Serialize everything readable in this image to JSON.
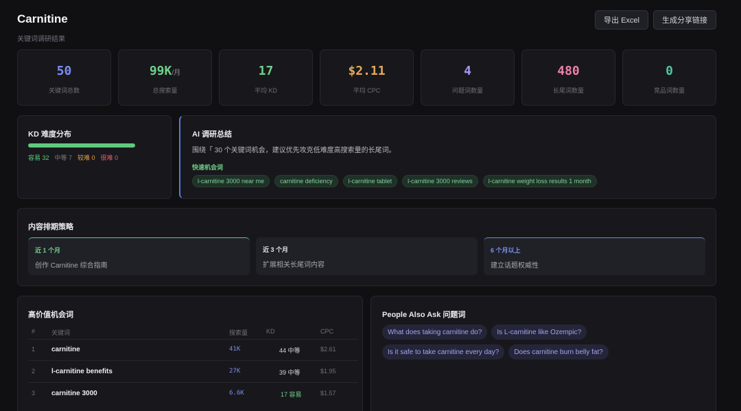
{
  "header": {
    "title": "Carnitine",
    "subtitle": "关键词调研结果",
    "export_label": "导出 Excel",
    "share_label": "生成分享链接"
  },
  "stats": [
    {
      "value": "50",
      "unit": "",
      "label": "关键词总数",
      "color": "#7b8cf5"
    },
    {
      "value": "99K",
      "unit": "/月",
      "label": "总搜索量",
      "color": "#6fd18a"
    },
    {
      "value": "17",
      "unit": "",
      "label": "平均 KD",
      "color": "#6fd18a"
    },
    {
      "value": "$2.11",
      "unit": "",
      "label": "平均 CPC",
      "color": "#e5a95a"
    },
    {
      "value": "4",
      "unit": "",
      "label": "问题词数量",
      "color": "#a598f2"
    },
    {
      "value": "480",
      "unit": "",
      "label": "长尾词数量",
      "color": "#ef7fa8"
    },
    {
      "value": "0",
      "unit": "",
      "label": "竞品词数量",
      "color": "#4fc49c"
    }
  ],
  "kd": {
    "title": "KD 难度分布",
    "easy_label": "容易 32",
    "medium_label": "中等 7",
    "hard_label": "较难 0",
    "very_hard_label": "很难 0",
    "easy_color": "#5fca7d",
    "medium_color": "#7a7a84",
    "hard_color": "#e3a04f",
    "very_hard_color": "#e0616f"
  },
  "ai": {
    "title": "AI 调研总结",
    "summary": "围绕「 30 个关键词机会，建议优先攻克低难度高搜索量的长尾词。",
    "quick_title": "快速机会词",
    "tags": [
      "l-carnitine 3000 near me",
      "carnitine deficiency",
      "l-carnitine tablet",
      "l-carnitine 3000 reviews",
      "l-carnitine weight loss results 1 month"
    ]
  },
  "strategy": {
    "title": "内容排期策略",
    "items": [
      {
        "period": "近 1 个月",
        "text": "创作 Carnitine 综合指南",
        "color": "#6fd18a"
      },
      {
        "period": "近 3 个月",
        "text": "扩展相关长尾词内容",
        "color": "#e6e6ea"
      },
      {
        "period": "6 个月以上",
        "text": "建立话题权威性",
        "color": "#7b93ee"
      }
    ]
  },
  "table": {
    "title": "高价值机会词",
    "headers": {
      "num": "#",
      "keyword": "关键词",
      "volume": "搜索量",
      "kd": "KD",
      "cpc": "CPC"
    },
    "rows": [
      {
        "num": "1",
        "keyword": "carnitine",
        "volume": "41K",
        "kd_value": "44",
        "kd_label": "中等",
        "kd_color": "#d6d6dc",
        "cpc": "$2.61"
      },
      {
        "num": "2",
        "keyword": "l-carnitine benefits",
        "volume": "27K",
        "kd_value": "39",
        "kd_label": "中等",
        "kd_color": "#d6d6dc",
        "cpc": "$1.95"
      },
      {
        "num": "3",
        "keyword": "carnitine 3000",
        "volume": "6.6K",
        "kd_value": "17",
        "kd_label": "容易",
        "kd_color": "#6fd18a",
        "cpc": "$1.57"
      }
    ]
  },
  "paa": {
    "title": "People Also Ask 问题词",
    "row1": [
      "What does taking carnitine do?",
      "Is L-carnitine like Ozempic?"
    ],
    "row2": [
      "Is it safe to take carnitine every day?",
      "Does carnitine burn belly fat?"
    ]
  }
}
